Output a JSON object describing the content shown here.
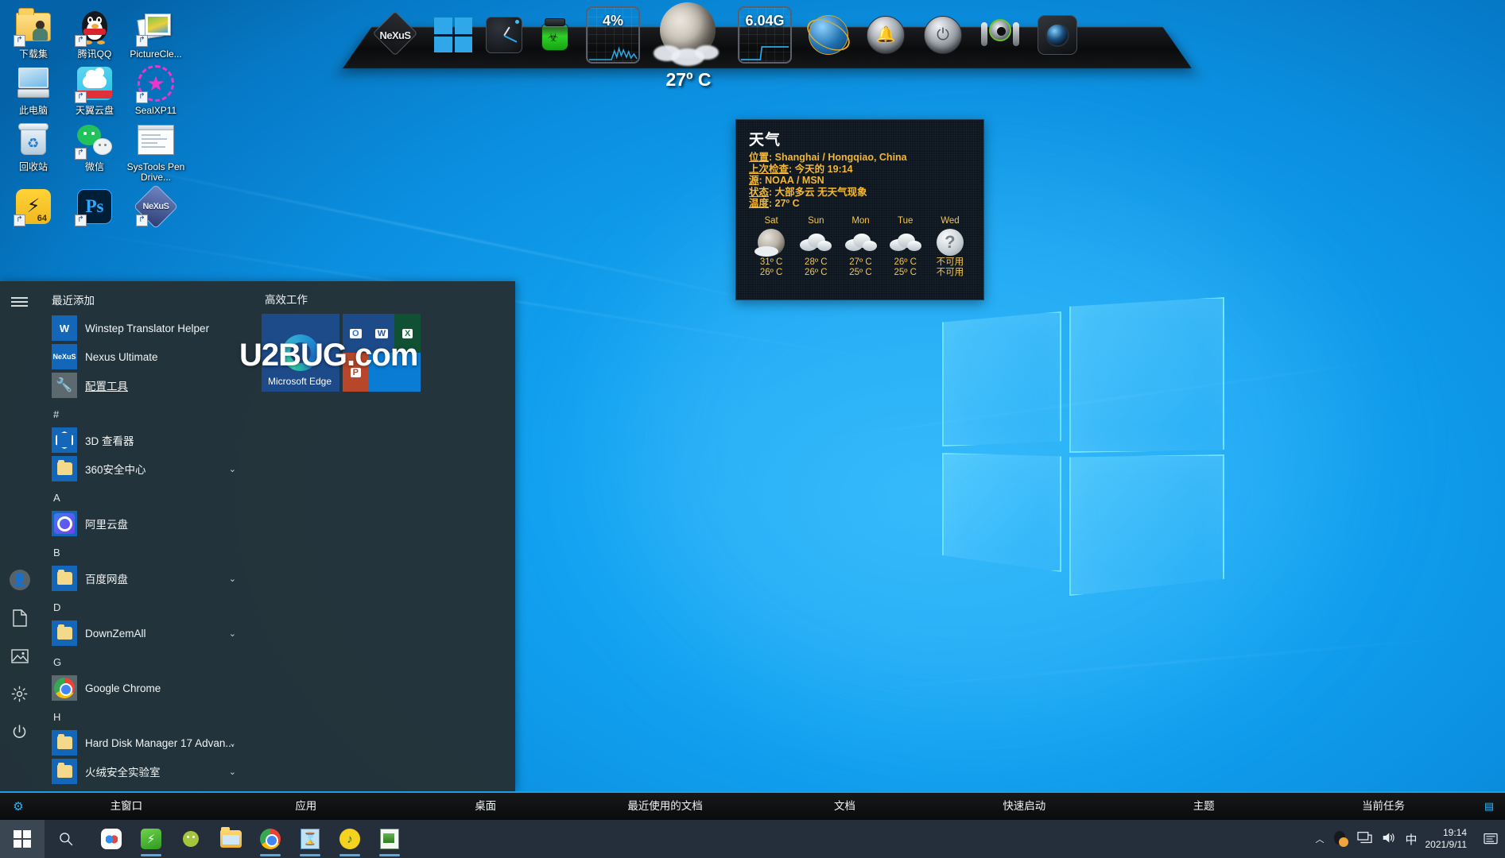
{
  "desktop": {
    "icons": [
      {
        "label": "下载集",
        "icon": "folder-user-icon"
      },
      {
        "label": "腾讯QQ",
        "icon": "qq-penguin-icon"
      },
      {
        "label": "PictureCle...",
        "icon": "picture-frames-icon"
      },
      {
        "label": "此电脑",
        "icon": "this-pc-monitor-icon"
      },
      {
        "label": "天翼云盘",
        "icon": "cloud-disk-icon"
      },
      {
        "label": "SealXP11",
        "icon": "seal-star-icon"
      },
      {
        "label": "回收站",
        "icon": "recycle-bin-icon"
      },
      {
        "label": "微信",
        "icon": "wechat-icon"
      },
      {
        "label": "SysTools Pen Drive...",
        "icon": "systools-window-icon"
      },
      {
        "label": "",
        "icon": "downloader-64-icon"
      },
      {
        "label": "",
        "icon": "photoshop-icon"
      },
      {
        "label": "",
        "icon": "nexus-diamond-icon"
      }
    ]
  },
  "dock": {
    "name": "nexus-dock",
    "items": [
      {
        "name": "nexus-logo-dock-icon",
        "label": "NeXuS"
      },
      {
        "name": "windows-start-dock-icon",
        "label": ""
      },
      {
        "name": "clock-dock-icon",
        "label": ""
      },
      {
        "name": "biohazard-dock-icon",
        "label": ""
      },
      {
        "name": "cpu-meter-dock-icon",
        "label": "4%"
      },
      {
        "name": "moon-weather-dock-icon",
        "label": "27º C"
      },
      {
        "name": "memory-meter-dock-icon",
        "label": "6.04G"
      },
      {
        "name": "network-globe-dock-icon",
        "label": ""
      },
      {
        "name": "alarm-bell-dock-icon",
        "label": ""
      },
      {
        "name": "power-dock-icon",
        "label": ""
      },
      {
        "name": "audio-headphone-dock-icon",
        "label": ""
      },
      {
        "name": "camera-dock-icon",
        "label": ""
      }
    ]
  },
  "weather": {
    "title": "天气",
    "rows": [
      {
        "key": "位置",
        "value": "Shanghai / Hongqiao, China"
      },
      {
        "key": "上次检查",
        "value": "今天的 19:14"
      },
      {
        "key": "源",
        "value": "NOAA / MSN"
      },
      {
        "key": "状态",
        "value": "大部多云 无天气现象"
      },
      {
        "key": "温度",
        "value": "27º C"
      }
    ],
    "forecast": [
      {
        "day": "Sat",
        "icon": "moon-cloud-icon",
        "high": "31º C",
        "low": "26º C"
      },
      {
        "day": "Sun",
        "icon": "cloud-icon",
        "high": "28º C",
        "low": "26º C"
      },
      {
        "day": "Mon",
        "icon": "cloud-icon",
        "high": "27º C",
        "low": "25º C"
      },
      {
        "day": "Tue",
        "icon": "cloud-icon",
        "high": "26º C",
        "low": "25º C"
      },
      {
        "day": "Wed",
        "icon": "unknown-icon",
        "high": "不可用",
        "low": "不可用"
      }
    ]
  },
  "start_menu": {
    "rail": [
      {
        "name": "hamburger-menu-icon"
      },
      {
        "name": "user-account-icon"
      },
      {
        "name": "documents-icon"
      },
      {
        "name": "pictures-icon"
      },
      {
        "name": "settings-gear-icon"
      },
      {
        "name": "power-icon"
      }
    ],
    "recent_header": "最近添加",
    "recent": [
      {
        "label": "Winstep Translator Helper",
        "icon": "winstep-icon",
        "chevron": false
      },
      {
        "label": "Nexus Ultimate",
        "icon": "nexus-icon",
        "chevron": false
      },
      {
        "label": "配置工具",
        "icon": "wrench-icon",
        "chevron": false
      }
    ],
    "groups": [
      {
        "letter": "#",
        "apps": [
          {
            "label": "3D 查看器",
            "icon": "cube-icon",
            "chevron": false
          },
          {
            "label": "360安全中心",
            "icon": "folder-icon",
            "chevron": true
          }
        ]
      },
      {
        "letter": "A",
        "apps": [
          {
            "label": "阿里云盘",
            "icon": "alibaba-cloud-icon",
            "chevron": false
          }
        ]
      },
      {
        "letter": "B",
        "apps": [
          {
            "label": "百度网盘",
            "icon": "folder-icon",
            "chevron": true
          }
        ]
      },
      {
        "letter": "D",
        "apps": [
          {
            "label": "DownZemAll",
            "icon": "folder-icon",
            "chevron": true
          }
        ]
      },
      {
        "letter": "G",
        "apps": [
          {
            "label": "Google Chrome",
            "icon": "chrome-icon",
            "chevron": false
          }
        ]
      },
      {
        "letter": "H",
        "apps": [
          {
            "label": "Hard Disk Manager 17 Advan...",
            "icon": "folder-icon",
            "chevron": true
          },
          {
            "label": "火绒安全实验室",
            "icon": "folder-icon",
            "chevron": true
          }
        ]
      }
    ],
    "tiles": {
      "group_title": "高效工作",
      "edge_label": "Microsoft Edge",
      "watermark": "U2BUG.com",
      "office": [
        {
          "name": "outlook-tile",
          "letter": "O"
        },
        {
          "name": "word-tile",
          "letter": "W"
        },
        {
          "name": "excel-tile",
          "letter": "X"
        },
        {
          "name": "powerpoint-tile",
          "letter": "P"
        },
        {
          "name": "store-tile",
          "letter": ""
        }
      ]
    }
  },
  "bottom_bar": {
    "gear_icon": "settings-gear-icon",
    "items": [
      {
        "label": "主窗口",
        "active": true
      },
      {
        "label": "应用",
        "active": false
      },
      {
        "label": "桌面",
        "active": false
      },
      {
        "label": "最近使用的文档",
        "active": false
      },
      {
        "label": "文档",
        "active": false
      },
      {
        "label": "快速启动",
        "active": false
      },
      {
        "label": "主题",
        "active": false
      },
      {
        "label": "当前任务",
        "active": false
      }
    ]
  },
  "taskbar": {
    "start_icon": "windows-start-icon",
    "search_icon": "search-icon",
    "apps": [
      {
        "name": "baidu-netdisk-taskbar-icon",
        "running": false
      },
      {
        "name": "green-app-taskbar-icon",
        "running": true
      },
      {
        "name": "android-emulator-taskbar-icon",
        "running": false
      },
      {
        "name": "file-explorer-taskbar-icon",
        "running": false
      },
      {
        "name": "chrome-taskbar-icon",
        "running": true
      },
      {
        "name": "hourglass-app-taskbar-icon",
        "running": true
      },
      {
        "name": "music-player-taskbar-icon",
        "running": true
      },
      {
        "name": "notepad-app-taskbar-icon",
        "running": true
      }
    ],
    "tray": [
      {
        "name": "show-hidden-icons-chevron",
        "glyph": "︿"
      },
      {
        "name": "qq-tray-icon",
        "glyph": ""
      },
      {
        "name": "network-tray-icon",
        "glyph": "🖳"
      },
      {
        "name": "volume-tray-icon",
        "glyph": "🔊"
      },
      {
        "name": "ime-language-tray-icon",
        "glyph": "中"
      }
    ],
    "clock": {
      "time": "19:14",
      "date": "2021/9/11"
    },
    "action_center_icon": "action-center-icon"
  },
  "colors": {
    "accent_blue": "#0aa0ef",
    "dock_blue": "#1e9fe8",
    "menu_bg": "#243136",
    "taskbar_bg": "#252f3b",
    "weather_amber": "#f3b733"
  }
}
